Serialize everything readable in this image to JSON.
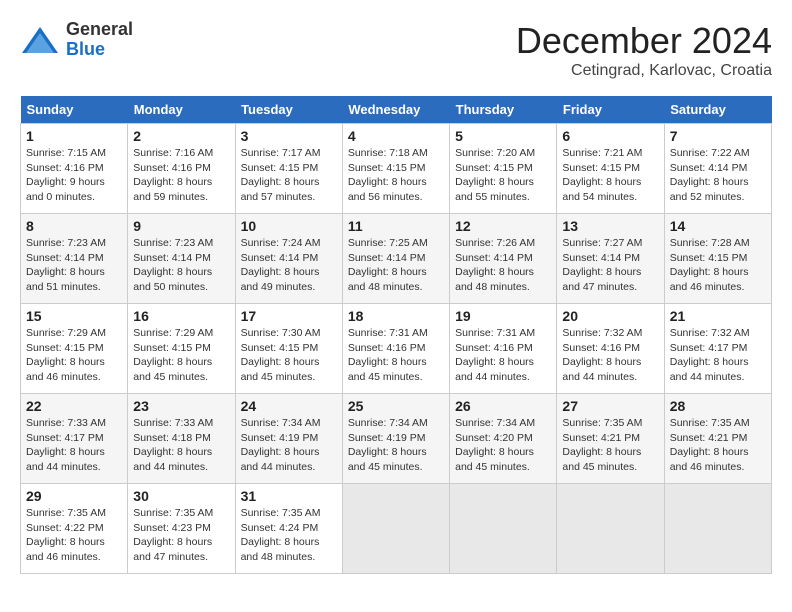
{
  "logo": {
    "general": "General",
    "blue": "Blue"
  },
  "title": "December 2024",
  "location": "Cetingrad, Karlovac, Croatia",
  "headers": [
    "Sunday",
    "Monday",
    "Tuesday",
    "Wednesday",
    "Thursday",
    "Friday",
    "Saturday"
  ],
  "weeks": [
    [
      {
        "day": "1",
        "info": "Sunrise: 7:15 AM\nSunset: 4:16 PM\nDaylight: 9 hours\nand 0 minutes."
      },
      {
        "day": "2",
        "info": "Sunrise: 7:16 AM\nSunset: 4:16 PM\nDaylight: 8 hours\nand 59 minutes."
      },
      {
        "day": "3",
        "info": "Sunrise: 7:17 AM\nSunset: 4:15 PM\nDaylight: 8 hours\nand 57 minutes."
      },
      {
        "day": "4",
        "info": "Sunrise: 7:18 AM\nSunset: 4:15 PM\nDaylight: 8 hours\nand 56 minutes."
      },
      {
        "day": "5",
        "info": "Sunrise: 7:20 AM\nSunset: 4:15 PM\nDaylight: 8 hours\nand 55 minutes."
      },
      {
        "day": "6",
        "info": "Sunrise: 7:21 AM\nSunset: 4:15 PM\nDaylight: 8 hours\nand 54 minutes."
      },
      {
        "day": "7",
        "info": "Sunrise: 7:22 AM\nSunset: 4:14 PM\nDaylight: 8 hours\nand 52 minutes."
      }
    ],
    [
      {
        "day": "8",
        "info": "Sunrise: 7:23 AM\nSunset: 4:14 PM\nDaylight: 8 hours\nand 51 minutes."
      },
      {
        "day": "9",
        "info": "Sunrise: 7:23 AM\nSunset: 4:14 PM\nDaylight: 8 hours\nand 50 minutes."
      },
      {
        "day": "10",
        "info": "Sunrise: 7:24 AM\nSunset: 4:14 PM\nDaylight: 8 hours\nand 49 minutes."
      },
      {
        "day": "11",
        "info": "Sunrise: 7:25 AM\nSunset: 4:14 PM\nDaylight: 8 hours\nand 48 minutes."
      },
      {
        "day": "12",
        "info": "Sunrise: 7:26 AM\nSunset: 4:14 PM\nDaylight: 8 hours\nand 48 minutes."
      },
      {
        "day": "13",
        "info": "Sunrise: 7:27 AM\nSunset: 4:14 PM\nDaylight: 8 hours\nand 47 minutes."
      },
      {
        "day": "14",
        "info": "Sunrise: 7:28 AM\nSunset: 4:15 PM\nDaylight: 8 hours\nand 46 minutes."
      }
    ],
    [
      {
        "day": "15",
        "info": "Sunrise: 7:29 AM\nSunset: 4:15 PM\nDaylight: 8 hours\nand 46 minutes."
      },
      {
        "day": "16",
        "info": "Sunrise: 7:29 AM\nSunset: 4:15 PM\nDaylight: 8 hours\nand 45 minutes."
      },
      {
        "day": "17",
        "info": "Sunrise: 7:30 AM\nSunset: 4:15 PM\nDaylight: 8 hours\nand 45 minutes."
      },
      {
        "day": "18",
        "info": "Sunrise: 7:31 AM\nSunset: 4:16 PM\nDaylight: 8 hours\nand 45 minutes."
      },
      {
        "day": "19",
        "info": "Sunrise: 7:31 AM\nSunset: 4:16 PM\nDaylight: 8 hours\nand 44 minutes."
      },
      {
        "day": "20",
        "info": "Sunrise: 7:32 AM\nSunset: 4:16 PM\nDaylight: 8 hours\nand 44 minutes."
      },
      {
        "day": "21",
        "info": "Sunrise: 7:32 AM\nSunset: 4:17 PM\nDaylight: 8 hours\nand 44 minutes."
      }
    ],
    [
      {
        "day": "22",
        "info": "Sunrise: 7:33 AM\nSunset: 4:17 PM\nDaylight: 8 hours\nand 44 minutes."
      },
      {
        "day": "23",
        "info": "Sunrise: 7:33 AM\nSunset: 4:18 PM\nDaylight: 8 hours\nand 44 minutes."
      },
      {
        "day": "24",
        "info": "Sunrise: 7:34 AM\nSunset: 4:19 PM\nDaylight: 8 hours\nand 44 minutes."
      },
      {
        "day": "25",
        "info": "Sunrise: 7:34 AM\nSunset: 4:19 PM\nDaylight: 8 hours\nand 45 minutes."
      },
      {
        "day": "26",
        "info": "Sunrise: 7:34 AM\nSunset: 4:20 PM\nDaylight: 8 hours\nand 45 minutes."
      },
      {
        "day": "27",
        "info": "Sunrise: 7:35 AM\nSunset: 4:21 PM\nDaylight: 8 hours\nand 45 minutes."
      },
      {
        "day": "28",
        "info": "Sunrise: 7:35 AM\nSunset: 4:21 PM\nDaylight: 8 hours\nand 46 minutes."
      }
    ],
    [
      {
        "day": "29",
        "info": "Sunrise: 7:35 AM\nSunset: 4:22 PM\nDaylight: 8 hours\nand 46 minutes."
      },
      {
        "day": "30",
        "info": "Sunrise: 7:35 AM\nSunset: 4:23 PM\nDaylight: 8 hours\nand 47 minutes."
      },
      {
        "day": "31",
        "info": "Sunrise: 7:35 AM\nSunset: 4:24 PM\nDaylight: 8 hours\nand 48 minutes."
      },
      {
        "day": "",
        "info": ""
      },
      {
        "day": "",
        "info": ""
      },
      {
        "day": "",
        "info": ""
      },
      {
        "day": "",
        "info": ""
      }
    ]
  ]
}
